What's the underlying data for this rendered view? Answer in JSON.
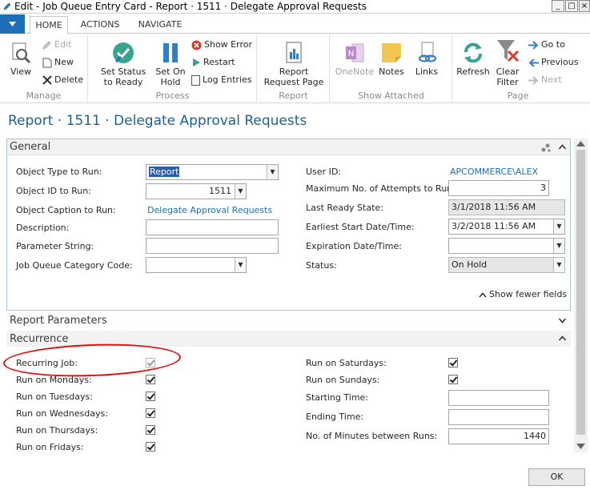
{
  "window": {
    "title": "Edit - Job Queue Entry Card - Report · 1511 · Delegate Approval Requests",
    "min_glyph": "_",
    "max_glyph": "□",
    "close_glyph": "×"
  },
  "tabs": [
    {
      "label": "HOME",
      "active": true
    },
    {
      "label": "ACTIONS",
      "active": false
    },
    {
      "label": "NAVIGATE",
      "active": false
    }
  ],
  "ribbon": {
    "manage": {
      "label": "Manage",
      "view": "View",
      "edit": "Edit",
      "new": "New",
      "delete": "Delete"
    },
    "process": {
      "label": "Process",
      "set_status_ready": "Set Status to Ready",
      "set_on_hold": "Set On Hold",
      "show_error": "Show Error",
      "restart": "Restart",
      "log_entries": "Log Entries"
    },
    "report": {
      "label": "Report",
      "report_request_page": "Report Request Page"
    },
    "show_attached": {
      "label": "Show Attached",
      "onenote": "OneNote",
      "notes": "Notes",
      "links": "Links"
    },
    "page": {
      "label": "Page",
      "refresh": "Refresh",
      "clear_filter": "Clear Filter",
      "go_to": "Go to",
      "previous": "Previous",
      "next": "Next"
    }
  },
  "page_title": "Report · 1511 · Delegate Approval Requests",
  "general": {
    "title": "General",
    "show_fewer_fields": "Show fewer fields",
    "left": {
      "object_type_label": "Object Type to Run:",
      "object_type_value": "Report",
      "object_id_label": "Object ID to Run:",
      "object_id_value": "1511",
      "object_caption_label": "Object Caption to Run:",
      "object_caption_value": "Delegate Approval Requests",
      "description_label": "Description:",
      "description_value": "",
      "parameter_string_label": "Parameter String:",
      "parameter_string_value": "",
      "category_code_label": "Job Queue Category Code:",
      "category_code_value": ""
    },
    "right": {
      "user_id_label": "User ID:",
      "user_id_value": "APCOMMERCE\\ALEX",
      "max_attempts_label": "Maximum No. of Attempts to Run:",
      "max_attempts_value": "3",
      "last_ready_label": "Last Ready State:",
      "last_ready_value": "3/1/2018 11:56 AM",
      "earliest_start_label": "Earliest Start Date/Time:",
      "earliest_start_value": "3/2/2018 11:56 AM",
      "expiration_label": "Expiration Date/Time:",
      "expiration_value": "",
      "status_label": "Status:",
      "status_value": "On Hold"
    }
  },
  "report_parameters": {
    "title": "Report Parameters"
  },
  "recurrence": {
    "title": "Recurrence",
    "recurring_job_label": "Recurring Job:",
    "mondays_label": "Run on Mondays:",
    "tuesdays_label": "Run on Tuesdays:",
    "wednesdays_label": "Run on Wednesdays:",
    "thursdays_label": "Run on Thursdays:",
    "fridays_label": "Run on Fridays:",
    "saturdays_label": "Run on Saturdays:",
    "sundays_label": "Run on Sundays:",
    "starting_time_label": "Starting Time:",
    "starting_time_value": "",
    "ending_time_label": "Ending Time:",
    "ending_time_value": "",
    "minutes_between_label": "No. of Minutes between Runs:",
    "minutes_between_value": "1440",
    "checks": {
      "recurring_job": true,
      "mondays": true,
      "tuesdays": true,
      "wednesdays": true,
      "thursdays": true,
      "fridays": true,
      "saturdays": true,
      "sundays": true
    }
  },
  "footer": {
    "ok_label": "OK"
  },
  "colors": {
    "accent_blue": "#1e6fb5",
    "title_blue": "#1f5f93",
    "annotation_red": "#e01010",
    "readonly_gray": "#e6e6e6"
  }
}
